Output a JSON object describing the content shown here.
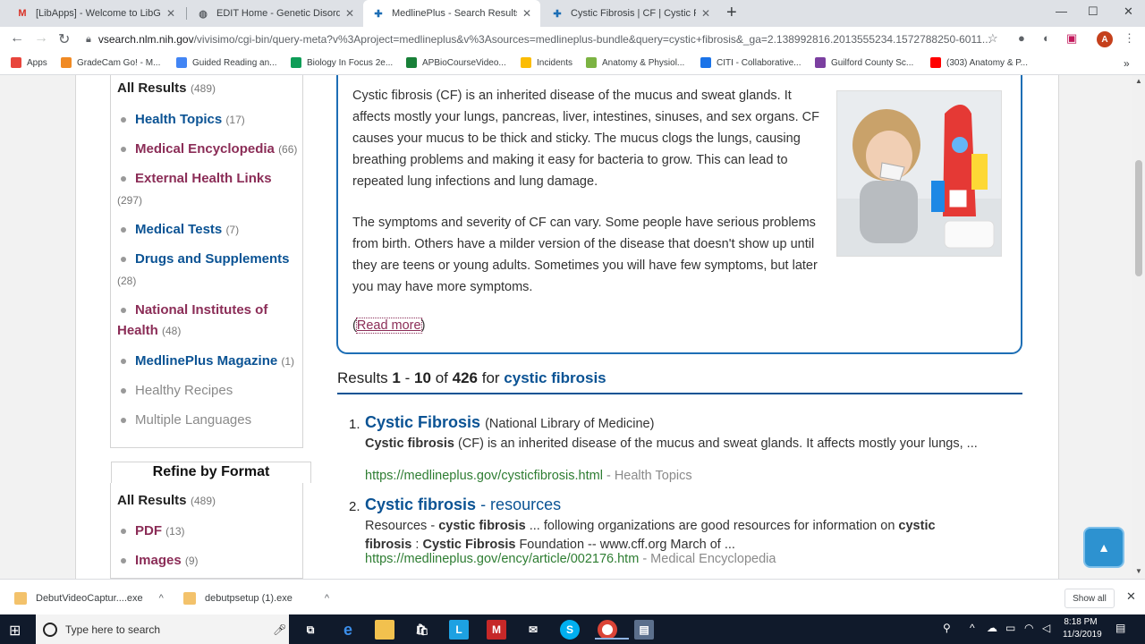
{
  "browser": {
    "tabs": [
      {
        "title": "[LibApps] - Welcome to LibGuides",
        "icon": "gmail-icon",
        "active": false
      },
      {
        "title": "EDIT Home - Genetic Disorders",
        "icon": "globe-icon",
        "active": false
      },
      {
        "title": "MedlinePlus - Search Results for",
        "icon": "medlineplus-icon",
        "active": true
      },
      {
        "title": "Cystic Fibrosis | CF | Cystic Fibrosis",
        "icon": "medlineplus-icon",
        "active": false
      }
    ],
    "url_host": "vsearch.nlm.nih.gov",
    "url_rest": "/vivisimo/cgi-bin/query-meta?v%3Aproject=medlineplus&v%3Asources=medlineplus-bundle&query=cystic+fibrosis&_ga=2.138992816.2013555234.1572788250-6011...",
    "profile_initial": "A",
    "bookmarks": [
      {
        "label": "Apps",
        "color": "#e8453c"
      },
      {
        "label": "GradeCam Go! - M...",
        "color": "#f08a24"
      },
      {
        "label": "Guided Reading an...",
        "color": "#4285f4"
      },
      {
        "label": "Biology In Focus 2e...",
        "color": "#0f9d58"
      },
      {
        "label": "APBioCourseVideo...",
        "color": "#188038"
      },
      {
        "label": "Incidents",
        "color": "#fbbc04"
      },
      {
        "label": "Anatomy & Physiol...",
        "color": "#7cb342"
      },
      {
        "label": "CITI - Collaborative...",
        "color": "#1a73e8"
      },
      {
        "label": "Guilford County Sc...",
        "color": "#7b3fa0"
      },
      {
        "label": "(303) Anatomy & P...",
        "color": "#ff0000"
      }
    ]
  },
  "sidebar": {
    "all_results_label": "All Results",
    "all_results_count": "(489)",
    "items": [
      {
        "label": "Health Topics",
        "count": "(17)"
      },
      {
        "label": "Medical Encyclopedia",
        "count": "(66)"
      },
      {
        "label": "External Health Links",
        "count": "(297)"
      },
      {
        "label": "Medical Tests",
        "count": "(7)"
      },
      {
        "label": "Drugs and Supplements",
        "count": "(28)"
      },
      {
        "label": "National Institutes of Health",
        "count": "(48)"
      },
      {
        "label": "MedlinePlus Magazine",
        "count": "(1)"
      },
      {
        "label": "Healthy Recipes",
        "count": ""
      },
      {
        "label": "Multiple Languages",
        "count": ""
      }
    ],
    "refine_title": "Refine by Format",
    "format_all_label": "All Results",
    "format_all_count": "(489)",
    "formats": [
      {
        "label": "PDF",
        "count": "(13)"
      },
      {
        "label": "Images",
        "count": "(9)"
      }
    ]
  },
  "summary": {
    "para1": "Cystic fibrosis (CF) is an inherited disease of the mucus and sweat glands. It affects mostly your lungs, pancreas, liver, intestines, sinuses, and sex organs. CF causes your mucus to be thick and sticky. The mucus clogs the lungs, causing breathing problems and making it easy for bacteria to grow. This can lead to repeated lung infections and lung damage.",
    "para2": "The symptoms and severity of CF can vary. Some people have serious problems from birth. Others have a milder version of the disease that doesn't show up until they are teens or young adults. Sometimes you will have few symptoms, but later you may have more symptoms.",
    "read_more_open": "(",
    "read_more": "Read more",
    "read_more_close": ")"
  },
  "results": {
    "head_prefix": "Results",
    "start": "1",
    "dash": "-",
    "end": "10",
    "of": "of",
    "total": "426",
    "for": "for",
    "query": "cystic fibrosis",
    "items": [
      {
        "num": "1.",
        "title": "Cystic Fibrosis",
        "title_suffix": "",
        "source": "(National Library of Medicine)",
        "snippet_html": "<b>Cystic fibrosis</b> (CF) is an inherited disease of the mucus and sweat glands. It affects mostly your lungs, ...",
        "url": "https://medlineplus.gov/cysticfibrosis.html",
        "category": "- Health Topics"
      },
      {
        "num": "2.",
        "title": "Cystic fibrosis",
        "title_suffix": "- resources",
        "source": "",
        "snippet_html": "Resources - <b>cystic fibrosis</b> ... following organizations are good resources for information on <b>cystic fibrosis</b> : <b>Cystic Fibrosis</b> Foundation -- www.cff.org March of ...",
        "url": "https://medlineplus.gov/ency/article/002176.htm",
        "category": "- Medical Encyclopedia"
      }
    ]
  },
  "downloads": [
    {
      "name": "DebutVideoCaptur....exe"
    },
    {
      "name": "debutpsetup (1).exe"
    }
  ],
  "downloads_show_all": "Show all",
  "taskbar": {
    "search_placeholder": "Type here to search",
    "time": "8:18 PM",
    "date": "11/3/2019"
  }
}
